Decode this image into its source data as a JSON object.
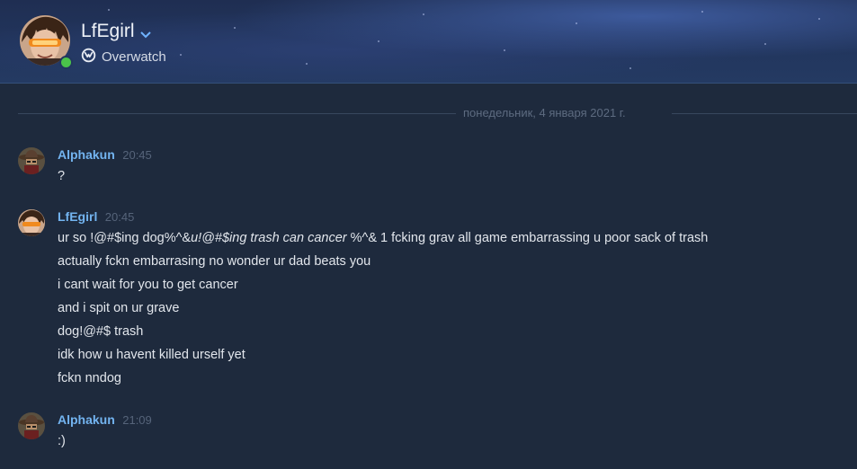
{
  "header": {
    "username": "LfEgirl",
    "status": "online",
    "game": "Overwatch",
    "game_icon": "overwatch-logo-icon",
    "online_color": "#4ac34a"
  },
  "date_divider": "понедельник, 4 января 2021 г.",
  "messages": [
    {
      "author": "Alphakun",
      "time": "20:45",
      "avatar": "cowboy-avatar",
      "lines": [
        "?"
      ]
    },
    {
      "author": "LfEgirl",
      "time": "20:45",
      "avatar": "tracer-avatar",
      "lines": [
        {
          "part1": "ur so !@#$ing dog%^&",
          "part2": "u!@#$ing trash can cancer",
          "part3": " %^& 1 fcking grav all game embarrassing u poor sack of trash"
        },
        "actually fckn embarrasing no wonder ur dad beats you",
        "i cant wait for you to get cancer",
        "and i spit on ur grave",
        "dog!@#$ trash",
        "idk how u havent killed urself yet",
        "fckn nndog"
      ]
    },
    {
      "author": "Alphakun",
      "time": "21:09",
      "avatar": "cowboy-avatar",
      "lines": [
        ":)"
      ]
    }
  ],
  "colors": {
    "background": "#1e2a3d",
    "author_name": "#73b4f0",
    "timestamp": "#56647a",
    "message_text": "#e2e6ec"
  }
}
